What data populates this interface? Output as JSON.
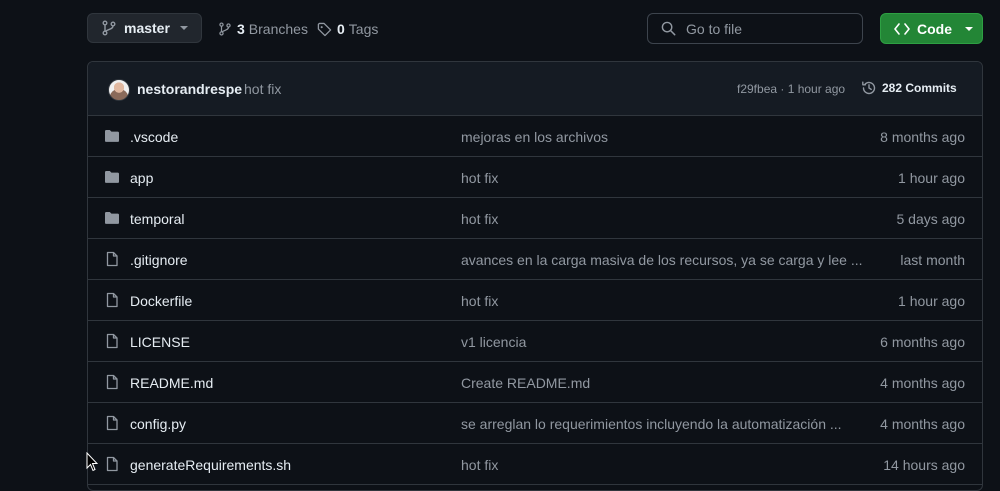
{
  "toolbar": {
    "branch": "master",
    "branches_count": "3",
    "branches_label": "Branches",
    "tags_count": "0",
    "tags_label": "Tags",
    "search_placeholder": "Go to file",
    "code_label": "Code"
  },
  "latest_commit": {
    "author": "nestorandrespe",
    "message": "hot fix",
    "sha_time": "f29fbea · 1 hour ago",
    "commits_count": "282 Commits"
  },
  "files": [
    {
      "name": ".vscode",
      "type": "folder",
      "message": "mejoras en los archivos",
      "date": "8 months ago"
    },
    {
      "name": "app",
      "type": "folder",
      "message": "hot fix",
      "date": "1 hour ago"
    },
    {
      "name": "temporal",
      "type": "folder",
      "message": "hot fix",
      "date": "5 days ago"
    },
    {
      "name": ".gitignore",
      "type": "file",
      "message": "avances en la carga masiva de los recursos, ya se carga y lee ...",
      "date": "last month"
    },
    {
      "name": "Dockerfile",
      "type": "file",
      "message": "hot fix",
      "date": "1 hour ago"
    },
    {
      "name": "LICENSE",
      "type": "file",
      "message": "v1 licencia",
      "date": "6 months ago"
    },
    {
      "name": "README.md",
      "type": "file",
      "message": "Create README.md",
      "date": "4 months ago"
    },
    {
      "name": "config.py",
      "type": "file",
      "message": "se arreglan lo requerimientos incluyendo la automatización ...",
      "date": "4 months ago"
    },
    {
      "name": "generateRequirements.sh",
      "type": "file",
      "message": "hot fix",
      "date": "14 hours ago"
    }
  ],
  "colors": {
    "background": "#0d1117",
    "border": "#30363d",
    "muted_text": "#9198a1",
    "code_button": "#238636"
  }
}
